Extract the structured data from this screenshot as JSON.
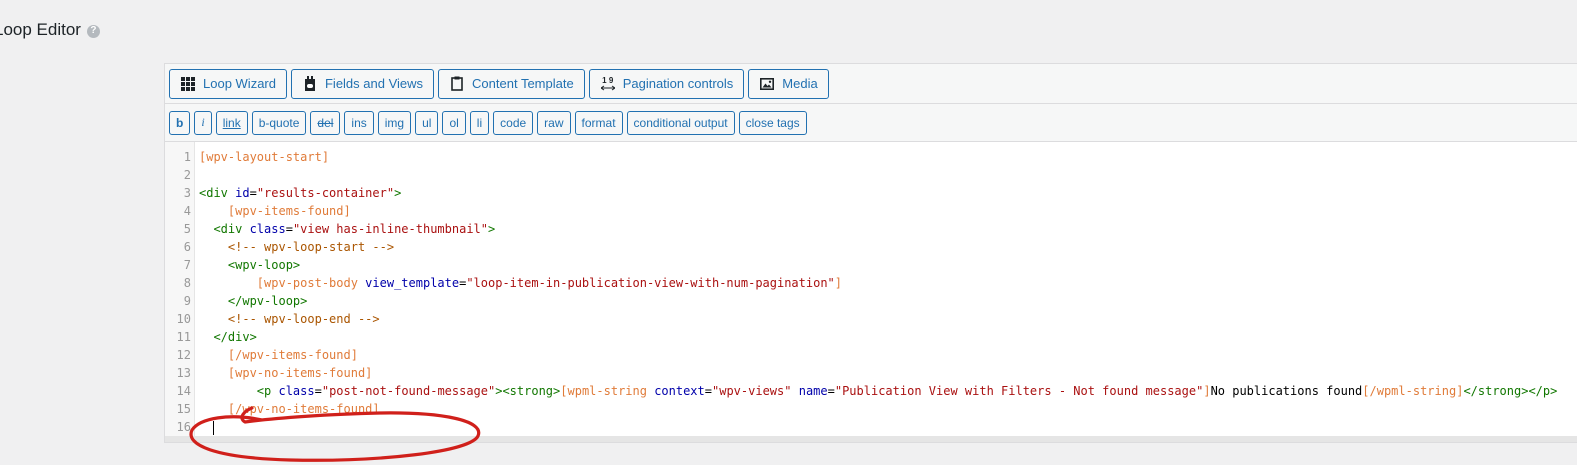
{
  "page": {
    "title": "Loop Editor",
    "help_glyph": "?"
  },
  "toolbar": {
    "buttons": [
      {
        "label": "Loop Wizard",
        "icon": "grid-icon"
      },
      {
        "label": "Fields and Views",
        "icon": "fields-icon"
      },
      {
        "label": "Content Template",
        "icon": "clipboard-icon"
      },
      {
        "label": "Pagination controls",
        "icon": "pagination-icon",
        "icon_text": "1 9"
      },
      {
        "label": "Media",
        "icon": "media-icon"
      }
    ]
  },
  "quicktags": [
    "b",
    "i",
    "link",
    "b-quote",
    "del",
    "ins",
    "img",
    "ul",
    "ol",
    "li",
    "code",
    "raw",
    "format",
    "conditional output",
    "close tags"
  ],
  "code": {
    "line_numbers": [
      "1",
      "2",
      "3",
      "4",
      "5",
      "6",
      "7",
      "8",
      "9",
      "10",
      "11",
      "12",
      "13",
      "14",
      "15",
      "16"
    ],
    "lines": [
      [
        {
          "c": "sc",
          "t": "[wpv-layout-start]"
        }
      ],
      [],
      [
        {
          "c": "tg",
          "t": "<div "
        },
        {
          "c": "at",
          "t": "id"
        },
        {
          "c": "tx",
          "t": "="
        },
        {
          "c": "st",
          "t": "\"results-container\""
        },
        {
          "c": "tg",
          "t": ">"
        }
      ],
      [
        {
          "c": "tx",
          "t": "    "
        },
        {
          "c": "sc",
          "t": "[wpv-items-found]"
        }
      ],
      [
        {
          "c": "tx",
          "t": "  "
        },
        {
          "c": "tg",
          "t": "<div "
        },
        {
          "c": "at",
          "t": "class"
        },
        {
          "c": "tx",
          "t": "="
        },
        {
          "c": "st",
          "t": "\"view has-inline-thumbnail\""
        },
        {
          "c": "tg",
          "t": ">"
        }
      ],
      [
        {
          "c": "tx",
          "t": "    "
        },
        {
          "c": "cm",
          "t": "<!-- wpv-loop-start -->"
        }
      ],
      [
        {
          "c": "tx",
          "t": "    "
        },
        {
          "c": "tg",
          "t": "<wpv-loop>"
        }
      ],
      [
        {
          "c": "tx",
          "t": "        "
        },
        {
          "c": "sc",
          "t": "[wpv-post-body "
        },
        {
          "c": "at",
          "t": "view_template"
        },
        {
          "c": "tx",
          "t": "="
        },
        {
          "c": "st",
          "t": "\"loop-item-in-publication-view-with-num-pagination\""
        },
        {
          "c": "sc",
          "t": "]"
        }
      ],
      [
        {
          "c": "tx",
          "t": "    "
        },
        {
          "c": "tg",
          "t": "</wpv-loop>"
        }
      ],
      [
        {
          "c": "tx",
          "t": "    "
        },
        {
          "c": "cm",
          "t": "<!-- wpv-loop-end -->"
        }
      ],
      [
        {
          "c": "tx",
          "t": "  "
        },
        {
          "c": "tg",
          "t": "</div>"
        }
      ],
      [
        {
          "c": "tx",
          "t": "    "
        },
        {
          "c": "sc",
          "t": "[/wpv-items-found]"
        }
      ],
      [
        {
          "c": "tx",
          "t": "    "
        },
        {
          "c": "sc",
          "t": "[wpv-no-items-found]"
        }
      ],
      [
        {
          "c": "tx",
          "t": "        "
        },
        {
          "c": "tg",
          "t": "<p "
        },
        {
          "c": "at",
          "t": "class"
        },
        {
          "c": "tx",
          "t": "="
        },
        {
          "c": "st",
          "t": "\"post-not-found-message\""
        },
        {
          "c": "tg",
          "t": "><strong>"
        },
        {
          "c": "sc",
          "t": "[wpml-string "
        },
        {
          "c": "at",
          "t": "context"
        },
        {
          "c": "tx",
          "t": "="
        },
        {
          "c": "st",
          "t": "\"wpv-views\""
        },
        {
          "c": "tx",
          "t": " "
        },
        {
          "c": "at",
          "t": "name"
        },
        {
          "c": "tx",
          "t": "="
        },
        {
          "c": "st",
          "t": "\"Publication View with Filters - Not found message\""
        },
        {
          "c": "sc",
          "t": "]"
        },
        {
          "c": "tx",
          "t": "No publications found"
        },
        {
          "c": "sc",
          "t": "[/wpml-string]"
        },
        {
          "c": "tg",
          "t": "</strong></p>"
        }
      ],
      [
        {
          "c": "tx",
          "t": "    "
        },
        {
          "c": "sc",
          "t": "[/wpv-no-items-found]"
        }
      ],
      [
        {
          "c": "tx",
          "t": "  "
        }
      ]
    ]
  },
  "annotation": {
    "shape": "hand-drawn ellipse",
    "color": "#d0201b"
  }
}
